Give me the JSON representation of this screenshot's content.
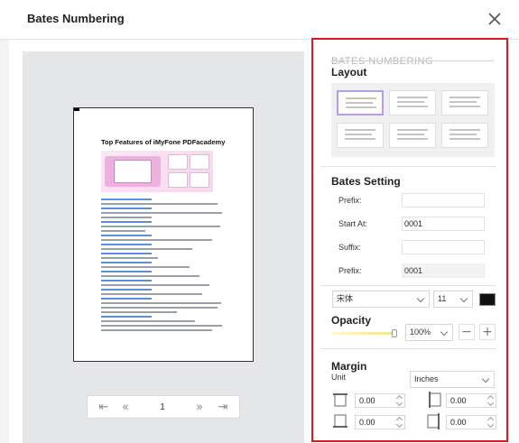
{
  "dialog": {
    "title": "Bates Numbering"
  },
  "preview": {
    "document_title": "Top Features of iMyFone PDFacademy",
    "page_number": "1"
  },
  "panel": {
    "header": "BATES NUMBERING",
    "layout": {
      "title": "Layout",
      "selected_index": 0
    },
    "bates_setting": {
      "title": "Bates Setting",
      "prefix_label": "Prefix:",
      "prefix_value": "",
      "start_label": "Start At:",
      "start_value": "0001",
      "suffix_label": "Suffix:",
      "suffix_value": "",
      "preview_prefix_label": "Prefix:",
      "preview_prefix_value": "0001"
    },
    "font": {
      "family": "宋体",
      "size": "11",
      "color": "#111111"
    },
    "opacity": {
      "title": "Opacity",
      "value": "100%",
      "level": 1.0
    },
    "margin": {
      "title": "Margin",
      "unit_label": "Unit",
      "unit_value": "Inches",
      "top": "0.00",
      "bottom": "0.00",
      "left": "0.00",
      "right": "0.00"
    }
  },
  "colors": {
    "highlight": "#e0151b",
    "selected_layout": "#b999ea"
  }
}
